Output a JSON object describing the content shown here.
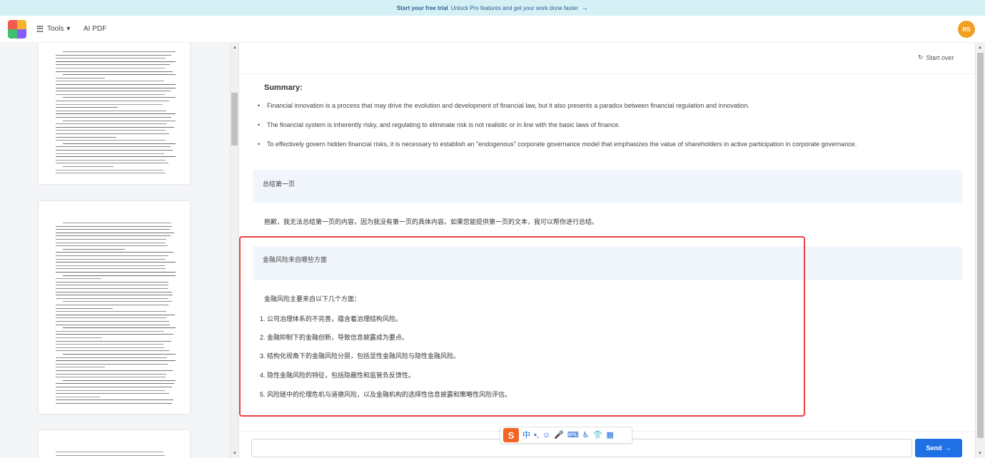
{
  "promo": {
    "bold": "Start your free trial",
    "text": "Unlock Pro features and get your work done faster",
    "arrow": "→"
  },
  "header": {
    "tools_label": "Tools",
    "tools_caret": "▾",
    "title": "AI PDF",
    "avatar_initials": "RS"
  },
  "colors": {
    "accent": "#1f6fe5",
    "highlight_border": "#e84343",
    "avatar": "#f2a024",
    "question_bg": "#f1f6fc"
  },
  "chat": {
    "start_over_icon": "↻",
    "start_over": "Start over",
    "summary_title": "Summary:",
    "summary_bullets": [
      "Financial innovation is a process that may drive the evolution and development of financial law, but it also presents a paradox between financial regulation and innovation.",
      "The financial system is inherently risky, and regulating to eliminate risk is not realistic or in line with the basic laws of finance.",
      "To effectively govern hidden financial risks, it is necessary to establish an \"endogenous\" corporate governance model that emphasizes the value of shareholders in active participation in corporate governance."
    ],
    "question1": "总结第一页",
    "answer1": "抱歉，我无法总结第一页的内容，因为我没有第一页的具体内容。如果您能提供第一页的文本，我可以帮你进行总结。",
    "question2": "金融风险来自哪些方面",
    "answer2_intro": "金融风险主要来自以下几个方面：",
    "answer2_items": [
      "1. 公司治理体系的不完善，蕴含着治理结构风险。",
      "2. 金融抑制下的金融创新，导致信息披露成为要点。",
      "3. 结构化视角下的金融风险分层，包括显性金融风险与隐性金融风险。",
      "4. 隐性金融风险的特征，包括隐蔽性和监管负反馈性。",
      "5. 风险链中的伦理危机与道德风险，以及金融机构的选择性信息披露和策略性风险评估。"
    ]
  },
  "input": {
    "value": "",
    "placeholder": ""
  },
  "send": {
    "label": "Send",
    "arrow": "→"
  },
  "ime": {
    "logo": "S",
    "icons": [
      "中",
      "•,",
      "☺",
      "🎤",
      "⌨",
      "♿",
      "👕",
      "▦"
    ]
  }
}
